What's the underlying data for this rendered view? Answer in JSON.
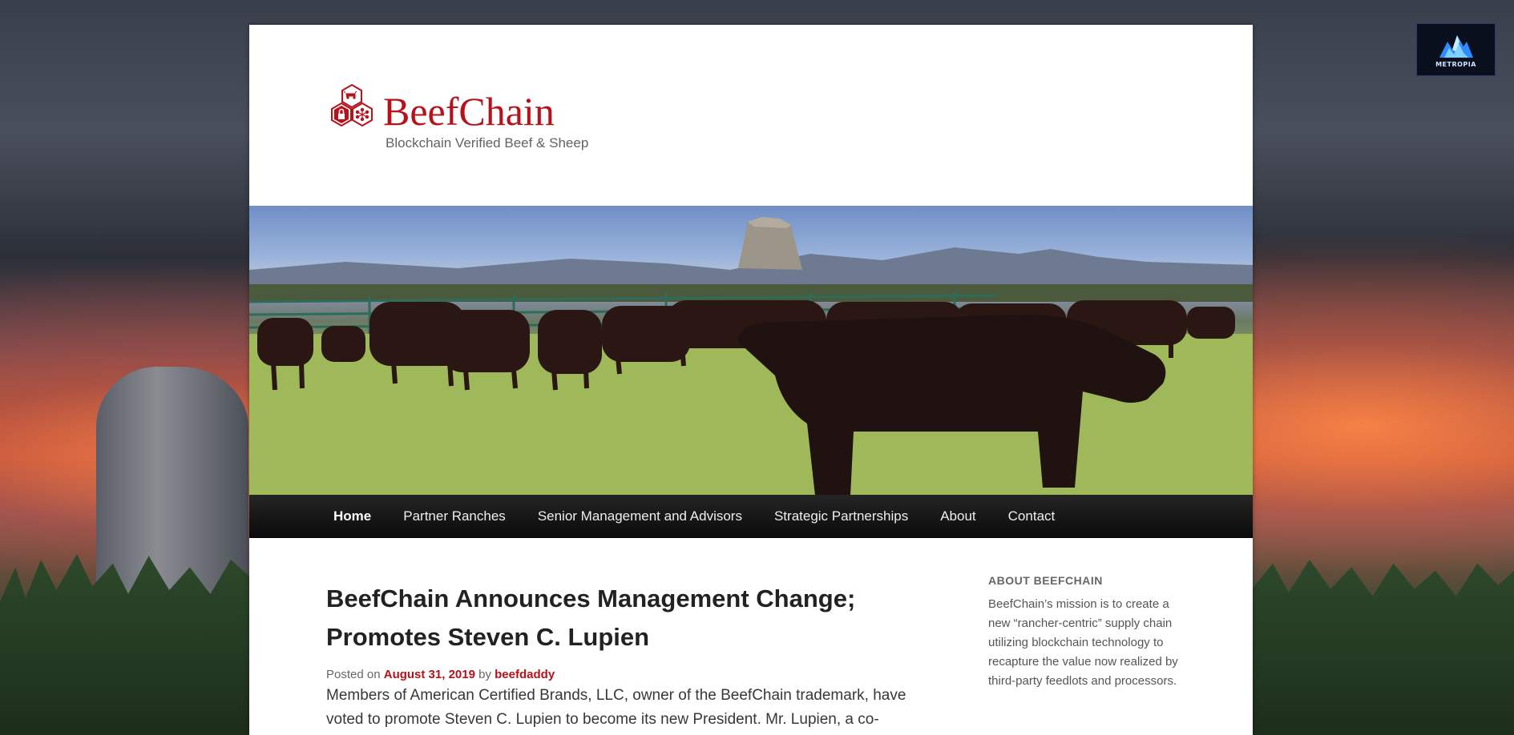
{
  "brand": {
    "title": "BeefChain",
    "tagline": "Blockchain Verified Beef & Sheep",
    "accent_color": "#b5121b"
  },
  "badge": {
    "label": "METROPIA",
    "icon": "metropia-logo-icon"
  },
  "nav": {
    "items": [
      {
        "label": "Home",
        "active": true
      },
      {
        "label": "Partner Ranches",
        "active": false
      },
      {
        "label": "Senior Management and Advisors",
        "active": false
      },
      {
        "label": "Strategic Partnerships",
        "active": false
      },
      {
        "label": "About",
        "active": false
      },
      {
        "label": "Contact",
        "active": false
      }
    ]
  },
  "post": {
    "title": "BeefChain Announces Management Change; Promotes Steven C. Lupien",
    "posted_on_label": "Posted on",
    "date": "August 31, 2019",
    "by_label": "by",
    "author": "beefdaddy",
    "excerpt": "Members of American Certified Brands, LLC, owner of the BeefChain trademark, have voted to promote Steven C. Lupien to become its new President. Mr. Lupien, a co-"
  },
  "sidebar": {
    "widget_title": "ABOUT BEEFCHAIN",
    "widget_text": "BeefChain’s mission is to create a new “rancher-centric” supply chain utilizing blockchain technology to recapture the value now realized by third-party feedlots and processors."
  }
}
